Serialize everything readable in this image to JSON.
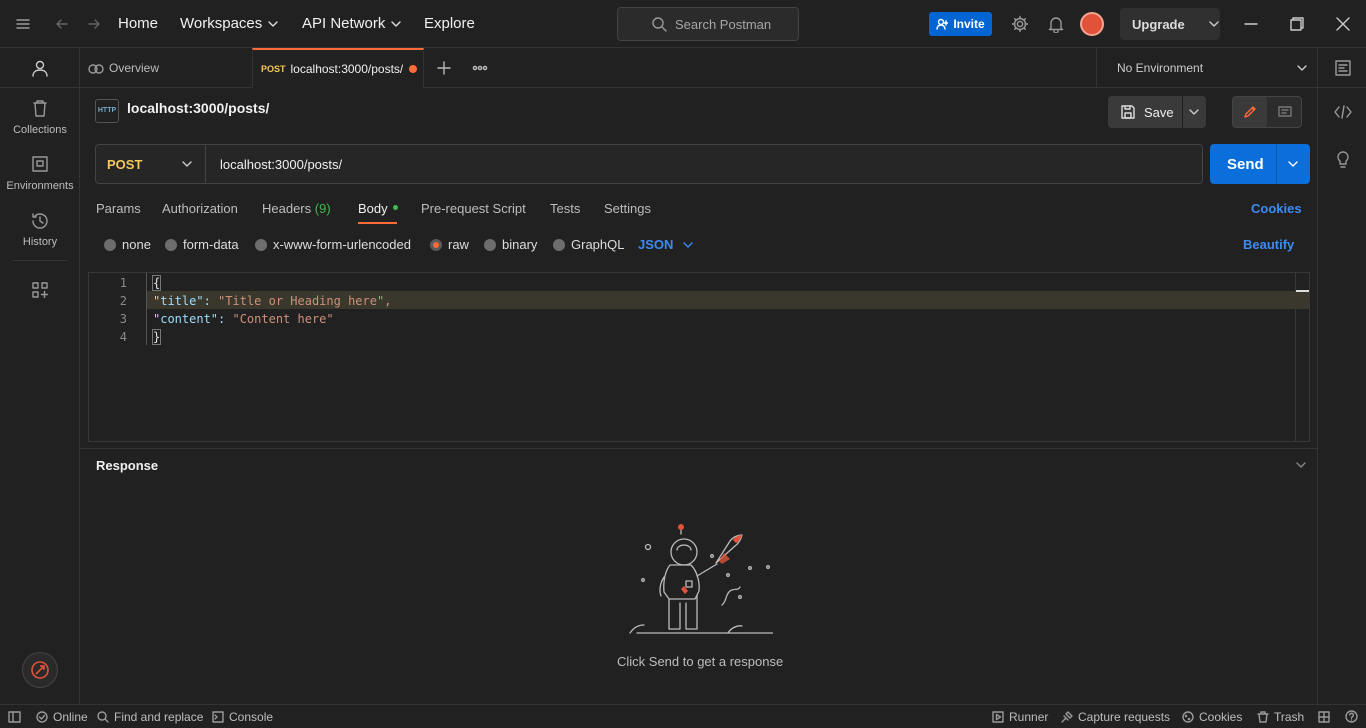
{
  "topbar": {
    "nav": [
      "Home",
      "Workspaces",
      "API Network",
      "Explore"
    ],
    "search_placeholder": "Search Postman",
    "invite": "Invite",
    "upgrade": "Upgrade"
  },
  "sidebar": {
    "items": [
      {
        "label": "Collections",
        "icon": "trash-bin-icon"
      },
      {
        "label": "Environments",
        "icon": "environment-icon"
      },
      {
        "label": "History",
        "icon": "history-icon"
      }
    ]
  },
  "tabs": {
    "overview": "Overview",
    "active_method": "POST",
    "active_title": "localhost:3000/posts/",
    "environment": "No Environment"
  },
  "request": {
    "title": "localhost:3000/posts/",
    "save": "Save",
    "method": "POST",
    "url": "localhost:3000/posts/",
    "send": "Send",
    "tabs": [
      "Params",
      "Authorization",
      "Headers",
      "(9)",
      "Body",
      "Pre-request Script",
      "Tests",
      "Settings"
    ],
    "cookies": "Cookies",
    "body_modes": [
      "none",
      "form-data",
      "x-www-form-urlencoded",
      "raw",
      "binary",
      "GraphQL"
    ],
    "format": "JSON",
    "beautify": "Beautify"
  },
  "editor": {
    "lines": [
      "1",
      "2",
      "3",
      "4"
    ],
    "code": [
      "{",
      "\"title\": \"Title or Heading here\",",
      "\"content\": \"Content here\"",
      "}"
    ]
  },
  "response": {
    "title": "Response",
    "empty_text": "Click Send to get a response"
  },
  "statusbar": {
    "online": "Online",
    "find": "Find and replace",
    "console": "Console",
    "runner": "Runner",
    "capture": "Capture requests",
    "cookies": "Cookies",
    "trash": "Trash"
  },
  "colors": {
    "accent": "#ff6c37",
    "primary": "#0b6fdb",
    "method_post": "#f5c85b",
    "link": "#3d8bf2"
  }
}
